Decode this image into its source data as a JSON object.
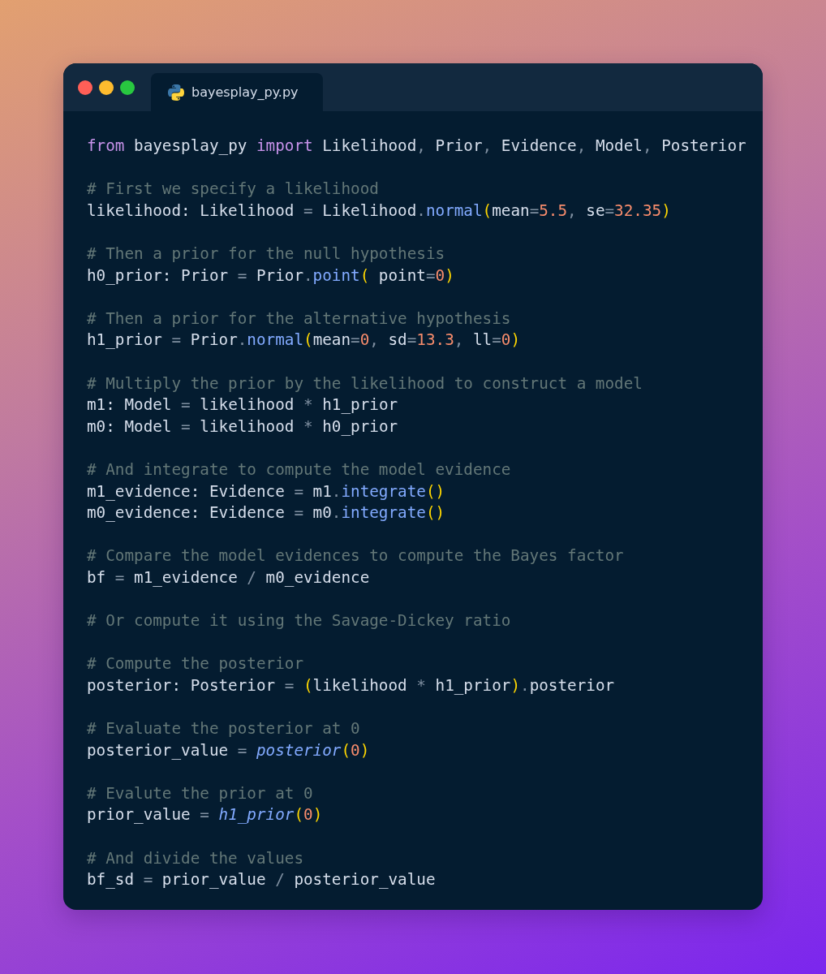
{
  "window": {
    "tabs": [
      {
        "label": "bayesplay_py.py",
        "selected": true
      }
    ]
  },
  "code": {
    "blocks": [
      {
        "lines": [
          [
            {
              "kind": "keyword",
              "text": "from"
            },
            {
              "kind": "plain",
              "text": " bayesplay_py "
            },
            {
              "kind": "keyword",
              "text": "import"
            },
            {
              "kind": "plain",
              "text": " Likelihood"
            },
            {
              "kind": "operator",
              "text": ","
            },
            {
              "kind": "plain",
              "text": " Prior"
            },
            {
              "kind": "operator",
              "text": ","
            },
            {
              "kind": "plain",
              "text": " Evidence"
            },
            {
              "kind": "operator",
              "text": ","
            },
            {
              "kind": "plain",
              "text": " Model"
            },
            {
              "kind": "operator",
              "text": ","
            },
            {
              "kind": "plain",
              "text": " Posterior"
            }
          ]
        ]
      },
      {
        "lines": [
          [
            {
              "kind": "comment",
              "text": "# First we specify a likelihood"
            }
          ],
          [
            {
              "kind": "plain",
              "text": "likelihood: Likelihood "
            },
            {
              "kind": "operator",
              "text": "="
            },
            {
              "kind": "plain",
              "text": " Likelihood"
            },
            {
              "kind": "operator",
              "text": "."
            },
            {
              "kind": "method",
              "text": "normal"
            },
            {
              "kind": "bracket",
              "text": "("
            },
            {
              "kind": "plain",
              "text": "mean"
            },
            {
              "kind": "operator",
              "text": "="
            },
            {
              "kind": "number",
              "text": "5.5"
            },
            {
              "kind": "operator",
              "text": ","
            },
            {
              "kind": "plain",
              "text": " se"
            },
            {
              "kind": "operator",
              "text": "="
            },
            {
              "kind": "number",
              "text": "32.35"
            },
            {
              "kind": "bracket",
              "text": ")"
            }
          ]
        ]
      },
      {
        "lines": [
          [
            {
              "kind": "comment",
              "text": "# Then a prior for the null hypothesis"
            }
          ],
          [
            {
              "kind": "plain",
              "text": "h0_prior: Prior "
            },
            {
              "kind": "operator",
              "text": "="
            },
            {
              "kind": "plain",
              "text": " Prior"
            },
            {
              "kind": "operator",
              "text": "."
            },
            {
              "kind": "method",
              "text": "point"
            },
            {
              "kind": "bracket",
              "text": "("
            },
            {
              "kind": "plain",
              "text": " point"
            },
            {
              "kind": "operator",
              "text": "="
            },
            {
              "kind": "number",
              "text": "0"
            },
            {
              "kind": "bracket",
              "text": ")"
            }
          ]
        ]
      },
      {
        "lines": [
          [
            {
              "kind": "comment",
              "text": "# Then a prior for the alternative hypothesis"
            }
          ],
          [
            {
              "kind": "plain",
              "text": "h1_prior "
            },
            {
              "kind": "operator",
              "text": "="
            },
            {
              "kind": "plain",
              "text": " Prior"
            },
            {
              "kind": "operator",
              "text": "."
            },
            {
              "kind": "method",
              "text": "normal"
            },
            {
              "kind": "bracket",
              "text": "("
            },
            {
              "kind": "plain",
              "text": "mean"
            },
            {
              "kind": "operator",
              "text": "="
            },
            {
              "kind": "number",
              "text": "0"
            },
            {
              "kind": "operator",
              "text": ","
            },
            {
              "kind": "plain",
              "text": " sd"
            },
            {
              "kind": "operator",
              "text": "="
            },
            {
              "kind": "number",
              "text": "13.3"
            },
            {
              "kind": "operator",
              "text": ","
            },
            {
              "kind": "plain",
              "text": " ll"
            },
            {
              "kind": "operator",
              "text": "="
            },
            {
              "kind": "number",
              "text": "0"
            },
            {
              "kind": "bracket",
              "text": ")"
            }
          ]
        ]
      },
      {
        "lines": [
          [
            {
              "kind": "comment",
              "text": "# Multiply the prior by the likelihood to construct a model"
            }
          ],
          [
            {
              "kind": "plain",
              "text": "m1: Model "
            },
            {
              "kind": "operator",
              "text": "="
            },
            {
              "kind": "plain",
              "text": " likelihood "
            },
            {
              "kind": "operator",
              "text": "*"
            },
            {
              "kind": "plain",
              "text": " h1_prior"
            }
          ],
          [
            {
              "kind": "plain",
              "text": "m0: Model "
            },
            {
              "kind": "operator",
              "text": "="
            },
            {
              "kind": "plain",
              "text": " likelihood "
            },
            {
              "kind": "operator",
              "text": "*"
            },
            {
              "kind": "plain",
              "text": " h0_prior"
            }
          ]
        ]
      },
      {
        "lines": [
          [
            {
              "kind": "comment",
              "text": "# And integrate to compute the model evidence"
            }
          ],
          [
            {
              "kind": "plain",
              "text": "m1_evidence: Evidence "
            },
            {
              "kind": "operator",
              "text": "="
            },
            {
              "kind": "plain",
              "text": " m1"
            },
            {
              "kind": "operator",
              "text": "."
            },
            {
              "kind": "method",
              "text": "integrate"
            },
            {
              "kind": "bracket",
              "text": "()"
            }
          ],
          [
            {
              "kind": "plain",
              "text": "m0_evidence: Evidence "
            },
            {
              "kind": "operator",
              "text": "="
            },
            {
              "kind": "plain",
              "text": " m0"
            },
            {
              "kind": "operator",
              "text": "."
            },
            {
              "kind": "method",
              "text": "integrate"
            },
            {
              "kind": "bracket",
              "text": "()"
            }
          ]
        ]
      },
      {
        "lines": [
          [
            {
              "kind": "comment",
              "text": "# Compare the model evidences to compute the Bayes factor"
            }
          ],
          [
            {
              "kind": "plain",
              "text": "bf "
            },
            {
              "kind": "operator",
              "text": "="
            },
            {
              "kind": "plain",
              "text": " m1_evidence "
            },
            {
              "kind": "operator",
              "text": "/"
            },
            {
              "kind": "plain",
              "text": " m0_evidence"
            }
          ]
        ]
      },
      {
        "lines": [
          [
            {
              "kind": "comment",
              "text": "# Or compute it using the Savage-Dickey ratio"
            }
          ]
        ]
      },
      {
        "lines": [
          [
            {
              "kind": "comment",
              "text": "# Compute the posterior"
            }
          ],
          [
            {
              "kind": "plain",
              "text": "posterior: Posterior "
            },
            {
              "kind": "operator",
              "text": "="
            },
            {
              "kind": "bracket",
              "text": " ("
            },
            {
              "kind": "plain",
              "text": "likelihood "
            },
            {
              "kind": "operator",
              "text": "*"
            },
            {
              "kind": "plain",
              "text": " h1_prior"
            },
            {
              "kind": "bracket",
              "text": ")"
            },
            {
              "kind": "operator",
              "text": "."
            },
            {
              "kind": "plain",
              "text": "posterior"
            }
          ]
        ]
      },
      {
        "lines": [
          [
            {
              "kind": "comment",
              "text": "# Evaluate the posterior at 0"
            }
          ],
          [
            {
              "kind": "plain",
              "text": "posterior_value "
            },
            {
              "kind": "operator",
              "text": "="
            },
            {
              "kind": "call",
              "text": " posterior"
            },
            {
              "kind": "bracket",
              "text": "("
            },
            {
              "kind": "number",
              "text": "0"
            },
            {
              "kind": "bracket",
              "text": ")"
            }
          ]
        ]
      },
      {
        "lines": [
          [
            {
              "kind": "comment",
              "text": "# Evalute the prior at 0"
            }
          ],
          [
            {
              "kind": "plain",
              "text": "prior_value "
            },
            {
              "kind": "operator",
              "text": "="
            },
            {
              "kind": "call",
              "text": " h1_prior"
            },
            {
              "kind": "bracket",
              "text": "("
            },
            {
              "kind": "number",
              "text": "0"
            },
            {
              "kind": "bracket",
              "text": ")"
            }
          ]
        ]
      },
      {
        "lines": [
          [
            {
              "kind": "comment",
              "text": "# And divide the values"
            }
          ],
          [
            {
              "kind": "plain",
              "text": "bf_sd "
            },
            {
              "kind": "operator",
              "text": "="
            },
            {
              "kind": "plain",
              "text": " prior_value "
            },
            {
              "kind": "operator",
              "text": "/"
            },
            {
              "kind": "plain",
              "text": " posterior_value"
            }
          ]
        ]
      }
    ]
  }
}
